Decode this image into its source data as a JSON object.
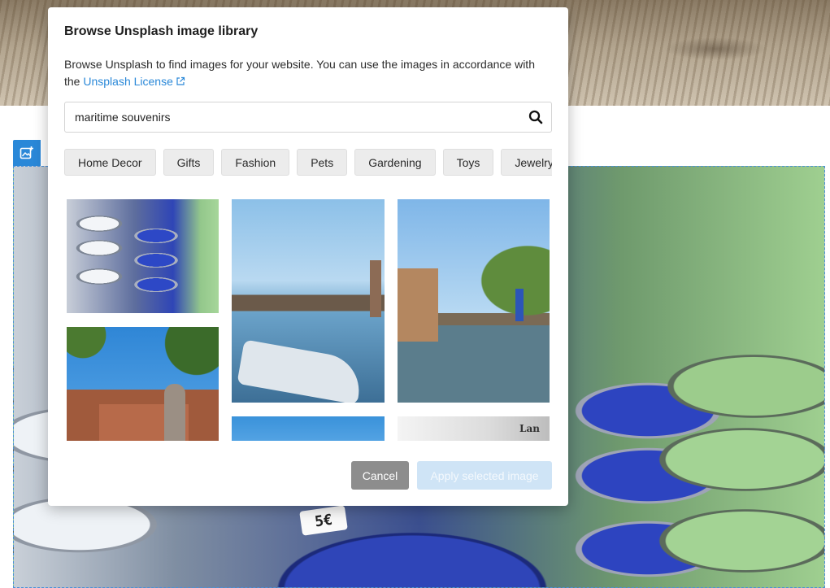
{
  "modal": {
    "title": "Browse Unsplash image library",
    "description": "Browse Unsplash to find images for your website. You can use the images in accordance with the",
    "license_link": "Unsplash License",
    "search": {
      "value": "maritime souvenirs",
      "icon": "search-icon"
    },
    "categories": [
      "Home Decor",
      "Gifts",
      "Fashion",
      "Pets",
      "Gardening",
      "Toys",
      "Jewelry"
    ],
    "results": [
      {
        "subject": "ceramic boats"
      },
      {
        "subject": "ornate building facade"
      },
      {
        "subject": "canal with boat"
      },
      {
        "subject": "canal houses"
      },
      {
        "subject": "blue sky"
      },
      {
        "subject": "shop sign"
      }
    ],
    "cancel_label": "Cancel",
    "apply_label": "Apply selected image",
    "apply_enabled": false
  },
  "background": {
    "price_tag": "5€"
  },
  "colors": {
    "accent": "#2a88d8",
    "cancel_bg": "#8d8d8d",
    "apply_disabled_bg": "#cfe4f6"
  }
}
